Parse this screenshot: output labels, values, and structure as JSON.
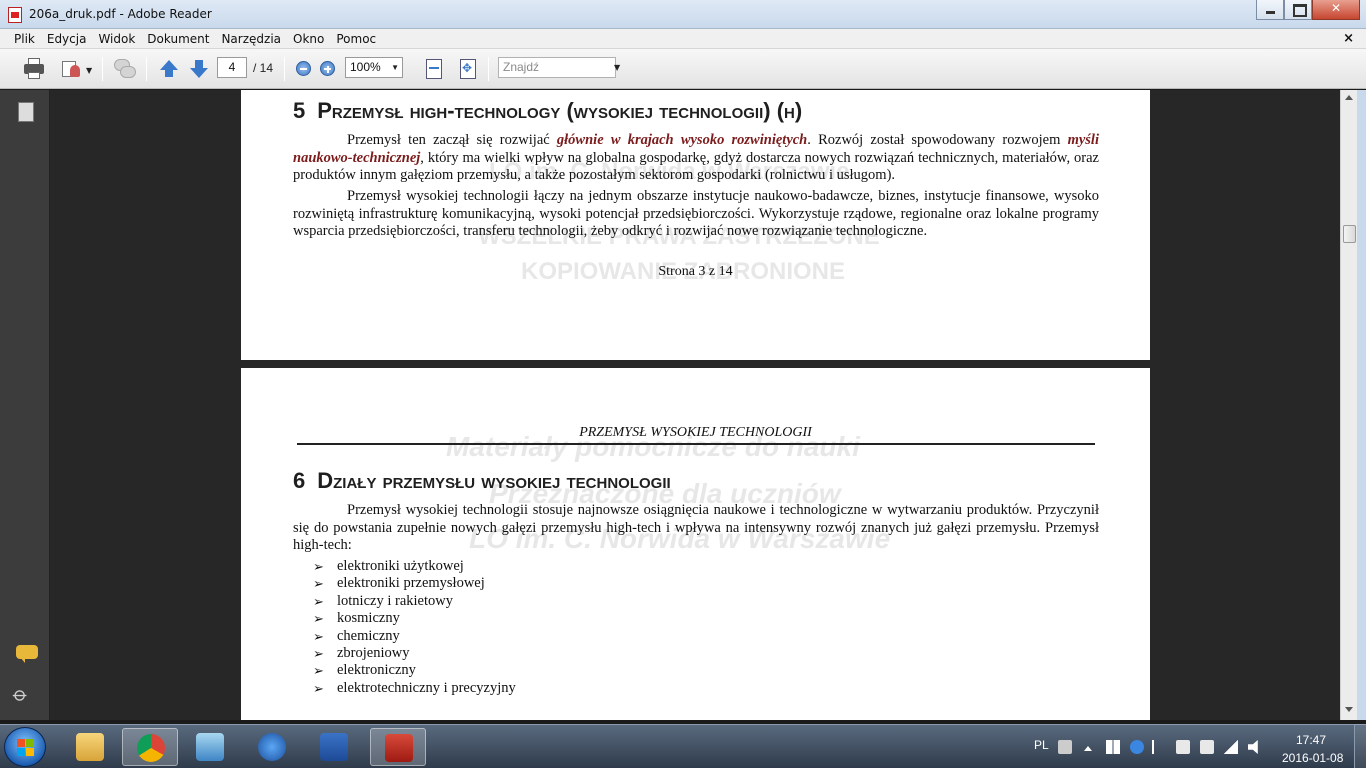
{
  "window": {
    "title": "206a_druk.pdf - Adobe Reader"
  },
  "menu": {
    "items": [
      "Plik",
      "Edycja",
      "Widok",
      "Dokument",
      "Narzędzia",
      "Okno",
      "Pomoc"
    ]
  },
  "toolbar": {
    "page_current": "4",
    "page_total": "/ 14",
    "zoom": "100%",
    "find_placeholder": "Znajdź"
  },
  "page1": {
    "heading_num": "5",
    "heading_text": "Przemysł high-technology (wysokiej technologii) (h)",
    "p1_a": "Przemysł ten zaczął się rozwijać ",
    "p1_em1": "głównie w krajach wysoko rozwiniętych",
    "p1_b": ". Rozwój został spowodowany rozwojem ",
    "p1_em2": "myśli naukowo-technicznej",
    "p1_c": ", który ma wielki wpływ na globalna gospodarkę, gdyż dostarcza nowych rozwiązań technicznych, materiałów, oraz produktów innym gałęziom przemysłu, a także pozostałym sektorom gospodarki (rolnictwu i usługom).",
    "p2": "Przemysł wysokiej technologii łączy na jednym obszarze instytucje naukowo-badawcze, biznes, instytucje finansowe, wysoko rozwiniętą infrastrukturę komunikacyjną, wysoki potencjał przedsiębiorczości. Wykorzystuje rządowe, regionalne oraz lokalne programy wsparcia przedsiębiorczości, transferu technologii, żeby odkryć i rozwijać nowe rozwiązanie technologiczne.",
    "footer": "Strona 3 z 14",
    "watermark_1": "WSZELKIE PRAWA ZASTRZEŻONE",
    "watermark_2": "KOPIOWANIE ZABRONIONE"
  },
  "page2": {
    "running_header": "PRZEMYSŁ WYSOKIEJ TECHNOLOGII",
    "heading_num": "6",
    "heading_text": "Działy przemysłu wysokiej technologii",
    "paragraph": "Przemysł wysokiej technologii stosuje najnowsze osiągnięcia naukowe i technologiczne w wytwarzaniu produktów. Przyczynił się do powstania zupełnie nowych gałęzi przemysłu high-tech i wpływa na intensywny rozwój znanych już gałęzi przemysłu. Przemysł high-tech:",
    "bullet": "➢",
    "list": [
      "elektroniki użytkowej",
      "elektroniki przemysłowej",
      "lotniczy i rakietowy",
      "kosmiczny",
      "chemiczny",
      "zbrojeniowy",
      "elektroniczny",
      "elektrotechniczny i precyzyjny"
    ],
    "watermark_1": "Materiały pomocnicze do nauki",
    "watermark_2": "Przeznaczone dla uczniów",
    "watermark_3": "LO im. C. Norwida w Warszawie"
  },
  "taskbar": {
    "language": "PL",
    "time": "17:47",
    "date": "2016-01-08",
    "apps": [
      "file-explorer",
      "chrome",
      "media-player",
      "flash-app",
      "word",
      "adobe-reader"
    ]
  }
}
